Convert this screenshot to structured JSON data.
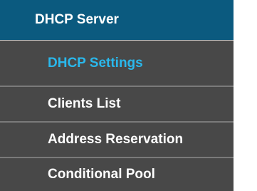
{
  "menu": {
    "header": "DHCP Server",
    "items": [
      {
        "label": "DHCP Settings",
        "active": true
      },
      {
        "label": "Clients List",
        "active": false
      },
      {
        "label": "Address Reservation",
        "active": false
      },
      {
        "label": "Conditional Pool",
        "active": false
      }
    ]
  },
  "colors": {
    "header_bg": "#0b5a7f",
    "item_bg": "#484848",
    "active_text": "#2ab8ec",
    "text": "#ffffff",
    "divider": "#7a7a7a"
  }
}
